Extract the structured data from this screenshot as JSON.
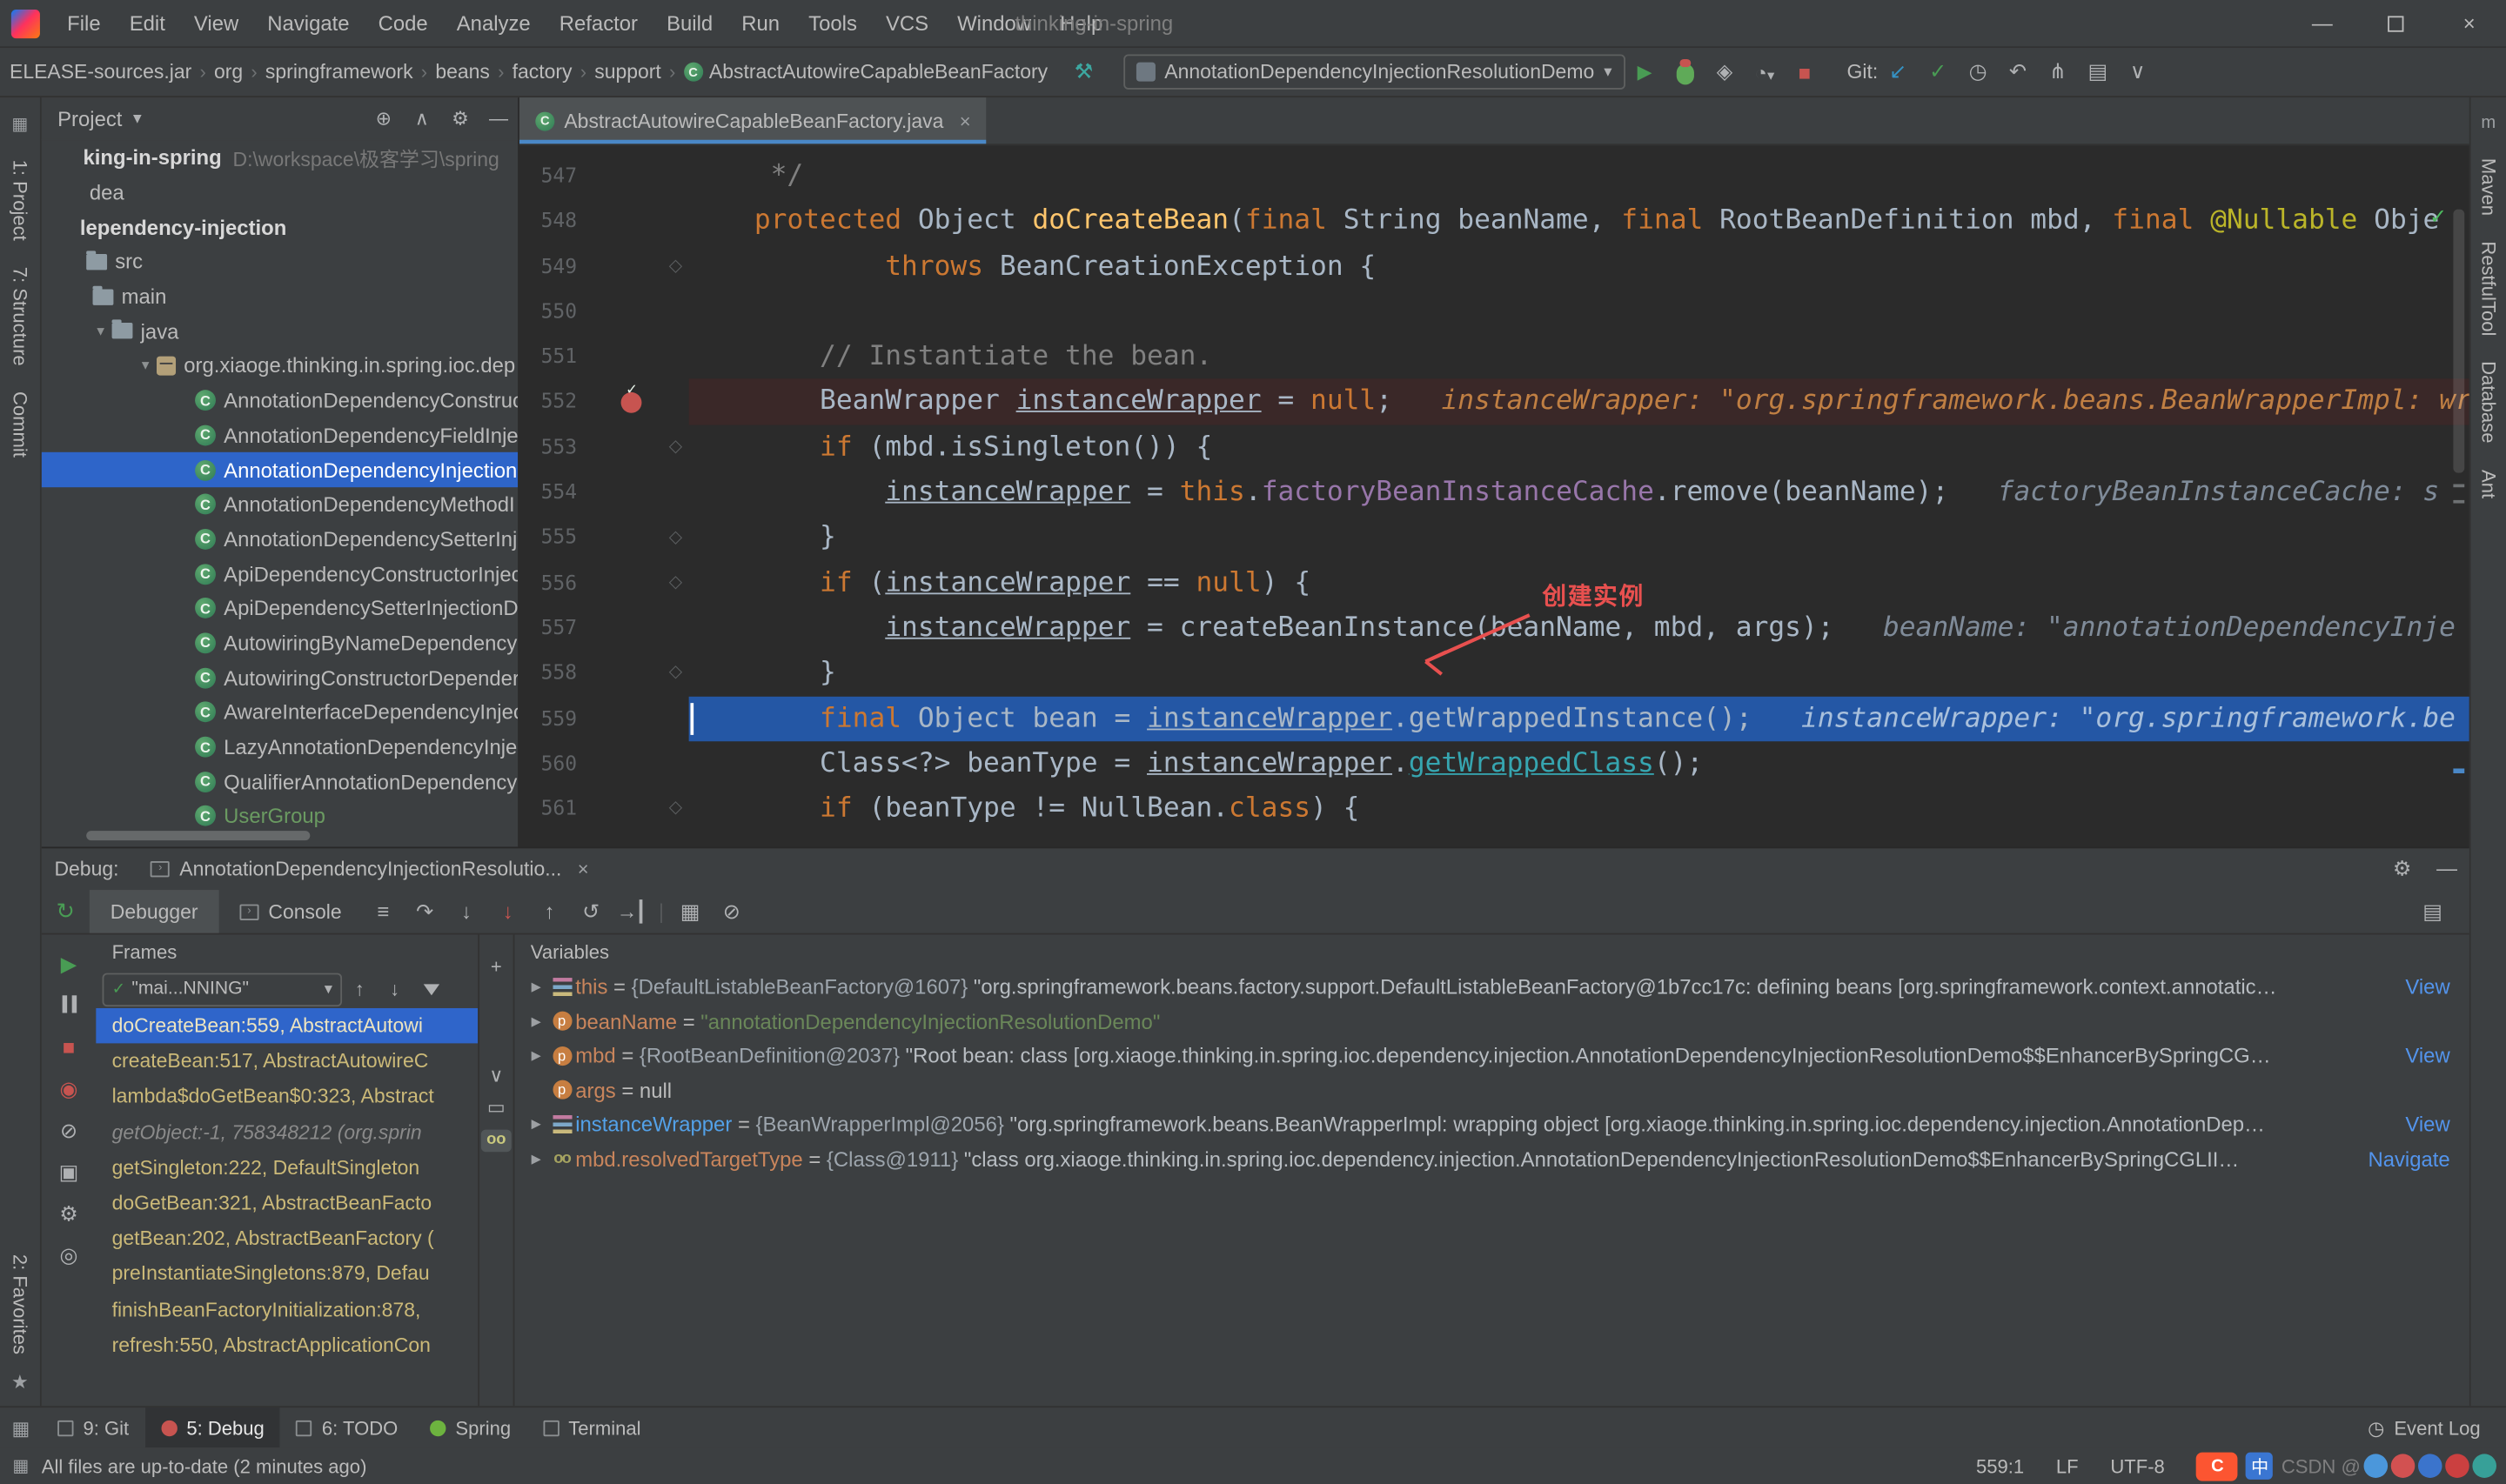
{
  "icons": {
    "minimize": "—",
    "close": "×",
    "combo_caret": "▾",
    "crumb_sep": "›",
    "wrench": "⚒",
    "run": "▶",
    "stop": "■",
    "coverage": "◈",
    "profiler": "◔",
    "update_project": "↙",
    "commit_check": "✓",
    "history": "◷",
    "rollback": "↶",
    "branch": "⋔",
    "restore_layout": "▤",
    "chevron_down": "∨",
    "chevron_up": "∧",
    "target": "⊕",
    "gear": "⚙",
    "hamburger": "≡",
    "rerun": "↻",
    "step_over": "↷",
    "step_into": "↓",
    "force_step_into": "↓",
    "step_out": "↑",
    "drop_frame": "↺",
    "run_to_cursor": "→",
    "view_breakpoints": "◉",
    "mute_breakpoints": "⊘",
    "camera": "▣",
    "pin": "◎",
    "resume": "▶",
    "add_watch": "+",
    "copy": "▭",
    "watch_glasses": "oo",
    "fold": "◇",
    "tree_arrow": "▼",
    "check_ok": "✓",
    "star": "★",
    "grid": "▦",
    "up": "↑",
    "down": "↓",
    "event_log": "◷",
    "maven_m": "m",
    "rest_o": "◦",
    "ant_a": "▲"
  },
  "titlebar": {
    "title": "thinking-in-spring",
    "menus": [
      "File",
      "Edit",
      "View",
      "Navigate",
      "Code",
      "Analyze",
      "Refactor",
      "Build",
      "Run",
      "Tools",
      "VCS",
      "Window",
      "Help"
    ]
  },
  "navbar": {
    "breadcrumbs": [
      "ELEASE-sources.jar",
      "org",
      "springframework",
      "beans",
      "factory",
      "support",
      "AbstractAutowireCapableBeanFactory"
    ],
    "run_config": "AnnotationDependencyInjectionResolutionDemo",
    "git_label": "Git:"
  },
  "left_strip": {
    "items": [
      "1: Project",
      "7: Structure",
      "Commit"
    ],
    "bottom": "2: Favorites"
  },
  "right_strip": {
    "items": [
      "Maven",
      "RestfulTool",
      "Database",
      "Ant"
    ]
  },
  "project_panel": {
    "header": "Project",
    "tree": [
      {
        "t": "king-in-spring",
        "s": " D:\\workspace\\极客学习\\spring",
        "b": true,
        "pad": 26
      },
      {
        "t": "dea",
        "pad": 30
      },
      {
        "t": "lependency-injection",
        "b": true,
        "pad": 24
      },
      {
        "t": "src",
        "ic": "folder",
        "pad": 28
      },
      {
        "t": "main",
        "ic": "folder",
        "pad": 32
      },
      {
        "t": "java",
        "ic": "folder",
        "ar": true,
        "pad": 30
      },
      {
        "t": "org.xiaoge.thinking.in.spring.ioc.dep",
        "ic": "package",
        "ar": true,
        "pad": 58
      },
      {
        "t": "AnnotationDependencyConstruc",
        "ic": "class",
        "pad": 96
      },
      {
        "t": "AnnotationDependencyFieldInje",
        "ic": "class",
        "pad": 96
      },
      {
        "t": "AnnotationDependencyInjection",
        "ic": "class",
        "pad": 96,
        "sel": true
      },
      {
        "t": "AnnotationDependencyMethodI",
        "ic": "class",
        "pad": 96
      },
      {
        "t": "AnnotationDependencySetterInj",
        "ic": "class",
        "pad": 96
      },
      {
        "t": "ApiDependencyConstructorInjec",
        "ic": "class",
        "pad": 96
      },
      {
        "t": "ApiDependencySetterInjectionD",
        "ic": "class",
        "pad": 96
      },
      {
        "t": "AutowiringByNameDependencyS",
        "ic": "class",
        "pad": 96
      },
      {
        "t": "AutowiringConstructorDepender",
        "ic": "class",
        "pad": 96
      },
      {
        "t": "AwareInterfaceDependencyInjec",
        "ic": "class",
        "pad": 96
      },
      {
        "t": "LazyAnnotationDependencyInjec",
        "ic": "class",
        "pad": 96
      },
      {
        "t": "QualifierAnnotationDependency",
        "ic": "class",
        "pad": 96
      },
      {
        "t": "UserGroup",
        "ic": "class",
        "pad": 96,
        "green": true
      }
    ]
  },
  "editor": {
    "tab": "AbstractAutowireCapableBeanFactory.java",
    "annotation": "创建实例",
    "lines": [
      {
        "no": "547",
        "seg": [
          [
            "cmt",
            "     */"
          ]
        ]
      },
      {
        "no": "548",
        "seg": [
          [
            "df",
            "    "
          ],
          [
            "kw",
            "protected"
          ],
          [
            "df",
            " Object "
          ],
          [
            "mth",
            "doCreateBean"
          ],
          [
            "df",
            "("
          ],
          [
            "kw",
            "final"
          ],
          [
            "df",
            " String beanName, "
          ],
          [
            "kw",
            "final"
          ],
          [
            "df",
            " RootBeanDefinition mbd, "
          ],
          [
            "kw",
            "final"
          ],
          [
            "df",
            " "
          ],
          [
            "ann",
            "@Nullable"
          ],
          [
            "df",
            " Obje"
          ]
        ]
      },
      {
        "no": "549",
        "fold": true,
        "seg": [
          [
            "df",
            "            "
          ],
          [
            "kw",
            "throws"
          ],
          [
            "df",
            " BeanCreationException {"
          ]
        ]
      },
      {
        "no": "550",
        "seg": []
      },
      {
        "no": "551",
        "seg": [
          [
            "df",
            "        "
          ],
          [
            "cmt",
            "// Instantiate the bean."
          ]
        ]
      },
      {
        "no": "552",
        "bp": true,
        "seg": [
          [
            "df",
            "        BeanWrapper "
          ],
          [
            "und",
            "instanceWrapper"
          ],
          [
            "df",
            " = "
          ],
          [
            "kw",
            "null"
          ],
          [
            "df",
            ";"
          ],
          [
            "hintA",
            "   instanceWrapper: \"org.springframework.beans.BeanWrapperImpl: wr"
          ]
        ]
      },
      {
        "no": "553",
        "fold": true,
        "seg": [
          [
            "df",
            "        "
          ],
          [
            "kw",
            "if"
          ],
          [
            "df",
            " (mbd.isSingleton()) {"
          ]
        ]
      },
      {
        "no": "554",
        "seg": [
          [
            "df",
            "            "
          ],
          [
            "und",
            "instanceWrapper"
          ],
          [
            "df",
            " = "
          ],
          [
            "kw",
            "this"
          ],
          [
            "df",
            "."
          ],
          [
            "fld",
            "factoryBeanInstanceCache"
          ],
          [
            "df",
            ".remove(beanName);"
          ],
          [
            "hint",
            "   factoryBeanInstanceCache: s"
          ]
        ]
      },
      {
        "no": "555",
        "fold": true,
        "seg": [
          [
            "df",
            "        }"
          ]
        ]
      },
      {
        "no": "556",
        "fold": true,
        "seg": [
          [
            "df",
            "        "
          ],
          [
            "kw",
            "if"
          ],
          [
            "df",
            " ("
          ],
          [
            "und",
            "instanceWrapper"
          ],
          [
            "df",
            " == "
          ],
          [
            "kw",
            "null"
          ],
          [
            "df",
            ") {"
          ]
        ]
      },
      {
        "no": "557",
        "seg": [
          [
            "df",
            "            "
          ],
          [
            "und",
            "instanceWrapper"
          ],
          [
            "df",
            " = createBeanInstance(beanName, mbd, args);"
          ],
          [
            "hint",
            "   beanName: \"annotationDependencyInje"
          ]
        ]
      },
      {
        "no": "558",
        "fold": true,
        "seg": [
          [
            "df",
            "        }"
          ]
        ]
      },
      {
        "no": "559",
        "exec": true,
        "seg": [
          [
            "df",
            "        "
          ],
          [
            "kw",
            "final"
          ],
          [
            "df",
            " Object bean = "
          ],
          [
            "und",
            "instanceWrapper"
          ],
          [
            "df",
            ".getWrappedInstance();"
          ],
          [
            "hintL",
            "   instanceWrapper: \"org.springframework.be"
          ]
        ]
      },
      {
        "no": "560",
        "seg": [
          [
            "df",
            "        Class<?> beanType = "
          ],
          [
            "und",
            "instanceWrapper"
          ],
          [
            "df",
            "."
          ],
          [
            "lnk",
            "getWrappedClass"
          ],
          [
            "df",
            "();"
          ]
        ]
      },
      {
        "no": "561",
        "fold": true,
        "seg": [
          [
            "df",
            "        "
          ],
          [
            "kw",
            "if"
          ],
          [
            "df",
            " (beanType != NullBean."
          ],
          [
            "kw",
            "class"
          ],
          [
            "df",
            ") {"
          ]
        ]
      }
    ]
  },
  "debug_panel": {
    "label": "Debug:",
    "tab": "AnnotationDependencyInjectionResolutio...",
    "tabs": [
      "Debugger",
      "Console"
    ],
    "frames": {
      "header": "Frames",
      "thread": "\"mai...NNING\"",
      "rows": [
        {
          "t": "doCreateBean:559, AbstractAutowi",
          "sel": true
        },
        {
          "t": "createBean:517, AbstractAutowireC"
        },
        {
          "t": "lambda$doGetBean$0:323, Abstract"
        },
        {
          "t": "getObject:-1, 758348212 (org.sprin",
          "lib": true
        },
        {
          "t": "getSingleton:222, DefaultSingleton"
        },
        {
          "t": "doGetBean:321, AbstractBeanFacto"
        },
        {
          "t": "getBean:202, AbstractBeanFactory ("
        },
        {
          "t": "preInstantiateSingletons:879, Defau"
        },
        {
          "t": "finishBeanFactoryInitialization:878,"
        },
        {
          "t": "refresh:550, AbstractApplicationCon"
        }
      ]
    },
    "variables": {
      "header": "Variables",
      "rows": [
        {
          "icon": "field",
          "exp": true,
          "name": "this",
          "segs": [
            [
              "eq",
              " = "
            ],
            [
              "ref",
              "{DefaultListableBeanFactory@1607} "
            ],
            [
              "vstr",
              "\"org.springframework.beans.factory.support.DefaultListableBeanFactory@1b7cc17c: defining beans [org.springframework.context.annotatic…"
            ]
          ],
          "link": "View"
        },
        {
          "icon": "param",
          "exp": true,
          "name": "beanName",
          "segs": [
            [
              "eq",
              " = "
            ],
            [
              "gstr",
              "\"annotationDependencyInjectionResolutionDemo\""
            ]
          ]
        },
        {
          "icon": "param",
          "exp": true,
          "name": "mbd",
          "segs": [
            [
              "eq",
              " = "
            ],
            [
              "ref",
              "{RootBeanDefinition@2037} "
            ],
            [
              "vstr",
              "\"Root bean: class [org.xiaoge.thinking.in.spring.ioc.dependency.injection.AnnotationDependencyInjectionResolutionDemo$$EnhancerBySpringCG…"
            ]
          ],
          "link": "View"
        },
        {
          "icon": "param",
          "exp": false,
          "name": "args",
          "segs": [
            [
              "eq",
              " = "
            ],
            [
              "plain",
              "null"
            ]
          ]
        },
        {
          "icon": "field",
          "exp": true,
          "name": "instanceWrapper",
          "changed": true,
          "segs": [
            [
              "eq",
              " = "
            ],
            [
              "ref",
              "{BeanWrapperImpl@2056} "
            ],
            [
              "vstr",
              "\"org.springframework.beans.BeanWrapperImpl: wrapping object [org.xiaoge.thinking.in.spring.ioc.dependency.injection.AnnotationDep…"
            ]
          ],
          "link": "View"
        },
        {
          "icon": "watch",
          "exp": true,
          "name": "mbd.resolvedTargetType",
          "segs": [
            [
              "eq",
              " = "
            ],
            [
              "ref",
              "{Class@1911} "
            ],
            [
              "vstr",
              "\"class org.xiaoge.thinking.in.spring.ioc.dependency.injection.AnnotationDependencyInjectionResolutionDemo$$EnhancerBySpringCGLII…"
            ]
          ],
          "link": "Navigate"
        }
      ]
    }
  },
  "statusbar": {
    "tools": [
      {
        "label": "9: Git",
        "icon": "git"
      },
      {
        "label": "5: Debug",
        "icon": "debug",
        "active": true
      },
      {
        "label": "6: TODO",
        "icon": "todo"
      },
      {
        "label": "Spring",
        "icon": "spring"
      },
      {
        "label": "Terminal",
        "icon": "terminal"
      }
    ],
    "event_log": "Event Log",
    "message": "All files are up-to-date (2 minutes ago)",
    "position": "559:1",
    "line_sep": "LF",
    "encoding": "UTF-8",
    "watermark": "CSDN @"
  }
}
